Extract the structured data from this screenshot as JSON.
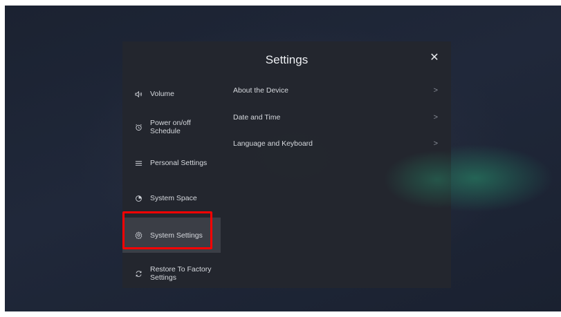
{
  "dialog": {
    "title": "Settings",
    "close_glyph": "✕"
  },
  "sidebar": {
    "items": [
      {
        "label": "Volume",
        "icon": "speaker-icon"
      },
      {
        "label": "Power on/off\nSchedule",
        "icon": "alarm-clock-icon"
      },
      {
        "label": "Personal Settings",
        "icon": "sliders-icon"
      },
      {
        "label": "System Space",
        "icon": "pie-chart-icon"
      },
      {
        "label": "System Settings",
        "icon": "gear-icon",
        "selected": true
      },
      {
        "label": "Restore To Factory\nSettings",
        "icon": "refresh-icon"
      }
    ]
  },
  "content": {
    "rows": [
      {
        "label": "About the Device",
        "chevron": ">"
      },
      {
        "label": "Date and Time",
        "chevron": ">"
      },
      {
        "label": "Language and Keyboard",
        "chevron": ">"
      }
    ]
  },
  "colors": {
    "highlight": "#ff0000",
    "dialog_bg": "#23262e",
    "selected_bg": "#3b3e46"
  }
}
